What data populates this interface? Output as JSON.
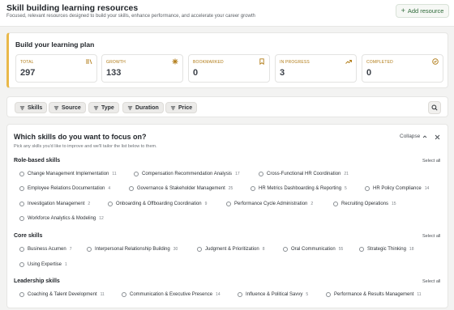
{
  "header": {
    "title": "Skill building learning resources",
    "subtitle": "Focused, relevant resources designed to build your skills, enhance performance, and accelerate your career growth",
    "add_label": "Add resource"
  },
  "plan": {
    "title": "Build your learning plan",
    "stats": [
      {
        "label": "TOTAL",
        "value": "297",
        "icon": "library-icon"
      },
      {
        "label": "GROWTH",
        "value": "133",
        "icon": "sparkle-icon"
      },
      {
        "label": "BOOKMARKED",
        "value": "0",
        "icon": "bookmark-icon"
      },
      {
        "label": "IN PROGRESS",
        "value": "3",
        "icon": "trend-up-icon"
      },
      {
        "label": "COMPLETED",
        "value": "0",
        "icon": "check-circle-icon"
      }
    ]
  },
  "filters": {
    "chips": [
      {
        "label": "Skills"
      },
      {
        "label": "Source"
      },
      {
        "label": "Type"
      },
      {
        "label": "Duration"
      },
      {
        "label": "Price"
      }
    ]
  },
  "focus": {
    "title": "Which skills do you want to focus on?",
    "subtitle": "Pick any skills you'd like to improve and we'll tailor the list below to them.",
    "collapse_label": "Collapse",
    "select_all_label": "Select all",
    "sections": [
      {
        "title": "Role-based skills",
        "skills": [
          {
            "label": "Change Management Implementation",
            "count": "11"
          },
          {
            "label": "Compensation Recommendation Analysis",
            "count": "17"
          },
          {
            "label": "Cross-Functional HR Coordination",
            "count": "21"
          },
          {
            "label": "Employee Relations Documentation",
            "count": "4"
          },
          {
            "label": "Governance & Stakeholder Management",
            "count": "25"
          },
          {
            "label": "HR Metrics Dashboarding & Reporting",
            "count": "5"
          },
          {
            "label": "HR Policy Compliance",
            "count": "14"
          },
          {
            "label": "Investigation Management",
            "count": "2"
          },
          {
            "label": "Onboarding & Offboarding Coordination",
            "count": "9"
          },
          {
            "label": "Performance Cycle Administration",
            "count": "2"
          },
          {
            "label": "Recruiting Operations",
            "count": "15"
          },
          {
            "label": "Workforce Analytics & Modeling",
            "count": "12"
          }
        ]
      },
      {
        "title": "Core skills",
        "skills": [
          {
            "label": "Business Acumen",
            "count": "7"
          },
          {
            "label": "Interpersonal Relationship Building",
            "count": "30"
          },
          {
            "label": "Judgment & Prioritization",
            "count": "8"
          },
          {
            "label": "Oral Communication",
            "count": "55"
          },
          {
            "label": "Strategic Thinking",
            "count": "18"
          },
          {
            "label": "Using Expertise",
            "count": "1"
          }
        ]
      },
      {
        "title": "Leadership skills",
        "skills": [
          {
            "label": "Coaching & Talent Development",
            "count": "11"
          },
          {
            "label": "Communication & Executive Presence",
            "count": "14"
          },
          {
            "label": "Influence & Political Savvy",
            "count": "5"
          },
          {
            "label": "Performance & Results Management",
            "count": "11"
          }
        ]
      }
    ]
  },
  "colors": {
    "accent": "#e9b849",
    "stat_label": "#b07a14",
    "add_button_text": "#2f6b3a"
  }
}
